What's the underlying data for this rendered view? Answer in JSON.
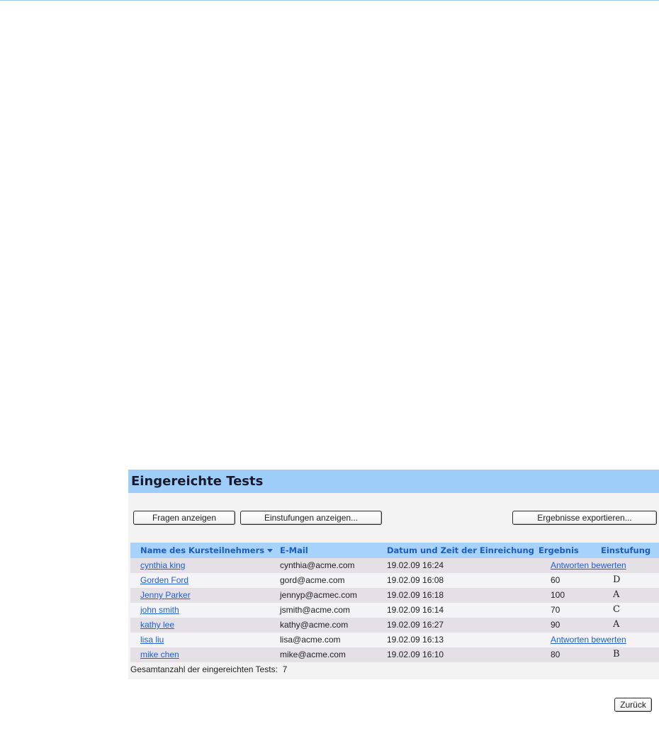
{
  "panel": {
    "title": "Eingereichte Tests",
    "buttons": {
      "view_questions": "Fragen anzeigen",
      "view_grades": "Einstufungen anzeigen...",
      "export_results": "Ergebnisse exportieren...",
      "back": "Zurück"
    },
    "columns": {
      "name": "Name des Kursteilnehmers",
      "email": "E-Mail",
      "datetime": "Datum und Zeit der Einreichung",
      "score": "Ergebnis",
      "grade": "Einstufung"
    },
    "sort_icon": "sort-descending-icon",
    "rows": [
      {
        "name": "cynthia king",
        "email": "cynthia@acme.com",
        "datetime": "19.02.09 16:24",
        "score": "",
        "grade": "",
        "action": "Antworten bewerten"
      },
      {
        "name": "Gorden Ford",
        "email": "gord@acme.com",
        "datetime": "19.02.09 16:08",
        "score": "60",
        "grade": "D",
        "action": ""
      },
      {
        "name": "Jenny Parker",
        "email": "jennyp@acmec.com",
        "datetime": "19.02.09 16:18",
        "score": "100",
        "grade": "A",
        "action": ""
      },
      {
        "name": "john smith",
        "email": "jsmith@acme.com",
        "datetime": "19.02.09 16:14",
        "score": "70",
        "grade": "C",
        "action": ""
      },
      {
        "name": "kathy lee",
        "email": "kathy@acme.com",
        "datetime": "19.02.09 16:27",
        "score": "90",
        "grade": "A",
        "action": ""
      },
      {
        "name": "lisa liu",
        "email": "lisa@acme.com",
        "datetime": "19.02.09 16:13",
        "score": "",
        "grade": "",
        "action": "Antworten bewerten"
      },
      {
        "name": "mike chen",
        "email": "mike@acme.com",
        "datetime": "19.02.09 16:10",
        "score": "80",
        "grade": "B",
        "action": ""
      }
    ],
    "totals": {
      "label": "Gesamtanzahl der eingereichten Tests:",
      "value": "7"
    }
  },
  "colors": {
    "header_bar": "#9fcdfa",
    "table_header": "#a7d3fb",
    "link": "#1f5fd1",
    "row_alt": "#e4e0e6",
    "panel_bg": "#f3f3f3"
  }
}
